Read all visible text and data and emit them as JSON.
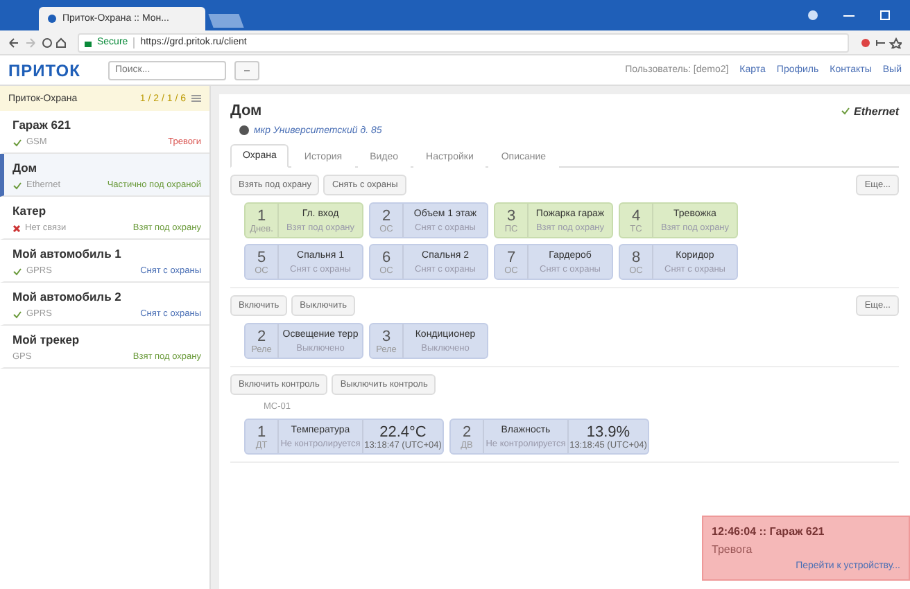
{
  "browser": {
    "tab_title": "Приток-Охрана :: Мон...",
    "secure": "Secure",
    "url": "https://grd.pritok.ru/client"
  },
  "header": {
    "logo": "ПРИТОК",
    "search": {
      "placeholder": "Поиск..."
    },
    "user": "Пользователь: [demo2]",
    "links": [
      "Карта",
      "Профиль",
      "Контакты",
      "Вый"
    ]
  },
  "sidebar": {
    "title": "Приток-Охрана",
    "counts": "1 / 2 / 1 / 6",
    "objects": [
      {
        "name": "Гараж 621",
        "channel": "GSM",
        "online": true,
        "status": "Тревоги",
        "color": "#d9534f",
        "selected": false
      },
      {
        "name": "Дом",
        "channel": "Ethernet",
        "online": true,
        "status": "Частично под охраной",
        "color": "#6a9a3a",
        "selected": true
      },
      {
        "name": "Катер",
        "channel": "Нет связи",
        "online": false,
        "status": "Взят под охрану",
        "color": "#6a9a3a",
        "selected": false
      },
      {
        "name": "Мой автомобиль 1",
        "channel": "GPRS",
        "online": true,
        "status": "Снят с охраны",
        "color": "#4a6fb5",
        "selected": false
      },
      {
        "name": "Мой автомобиль 2",
        "channel": "GPRS",
        "online": true,
        "status": "Снят с охраны",
        "color": "#4a6fb5",
        "selected": false
      },
      {
        "name": "Мой трекер",
        "channel": "GPS",
        "status": "Взят под охрану",
        "color": "#6a9a3a",
        "selected": false
      }
    ]
  },
  "object": {
    "title": "Дом",
    "address": "мкр Университетский д. 85",
    "connection": "Ethernet",
    "tabs": [
      {
        "label": "Охрана",
        "selected": true
      },
      {
        "label": "История",
        "selected": false
      },
      {
        "label": "Видео",
        "selected": false
      },
      {
        "label": "Настройки",
        "selected": false
      },
      {
        "label": "Описание",
        "selected": false
      }
    ],
    "zones_section": {
      "buttons": [
        "Взять под охрану",
        "Снять с охраны"
      ],
      "more": "Еще...",
      "items": [
        {
          "number": "1",
          "type": "Днев.",
          "name": "Гл. вход",
          "state": "Взят под охрану",
          "armed": true
        },
        {
          "number": "2",
          "type": "ОС",
          "name": "Объем 1 этаж",
          "state": "Снят с охраны",
          "armed": false
        },
        {
          "number": "3",
          "type": "ПС",
          "name": "Пожарка гараж",
          "state": "Взят под охрану",
          "armed": true
        },
        {
          "number": "4",
          "type": "ТС",
          "name": "Тревожка",
          "state": "Взят под охрану",
          "armed": true
        },
        {
          "number": "5",
          "type": "ОС",
          "name": "Спальня 1",
          "state": "Снят с охраны",
          "armed": false
        },
        {
          "number": "6",
          "type": "ОС",
          "name": "Спальня 2",
          "state": "Снят с охраны",
          "armed": false
        },
        {
          "number": "7",
          "type": "ОС",
          "name": "Гардероб",
          "state": "Снят с охраны",
          "armed": false
        },
        {
          "number": "8",
          "type": "ОС",
          "name": "Коридор",
          "state": "Снят с охраны",
          "armed": false
        }
      ]
    },
    "relays_section": {
      "buttons": [
        "Включить",
        "Выключить"
      ],
      "more": "Еще...",
      "items": [
        {
          "number": "2",
          "type": "Реле",
          "name": "Освещение терр",
          "state": "Выключено",
          "armed": false
        },
        {
          "number": "3",
          "type": "Реле",
          "name": "Кондиционер",
          "state": "Выключено",
          "armed": false
        }
      ]
    },
    "sensors_section": {
      "buttons": [
        "Включить контроль",
        "Выключить контроль"
      ],
      "group": "MC-01",
      "items": [
        {
          "number": "1",
          "type": "ДТ",
          "name": "Температура",
          "state": "Не контролируется",
          "value": "22.4°C",
          "time": "13:18:47 (UTC+04)"
        },
        {
          "number": "2",
          "type": "ДВ",
          "name": "Влажность",
          "state": "Не контролируется",
          "value": "13.9%",
          "time": "13:18:45 (UTC+04)"
        }
      ]
    }
  },
  "notification": {
    "title": "12:46:04 :: Гараж 621",
    "message": "Тревога",
    "link": "Перейти к устройству..."
  }
}
